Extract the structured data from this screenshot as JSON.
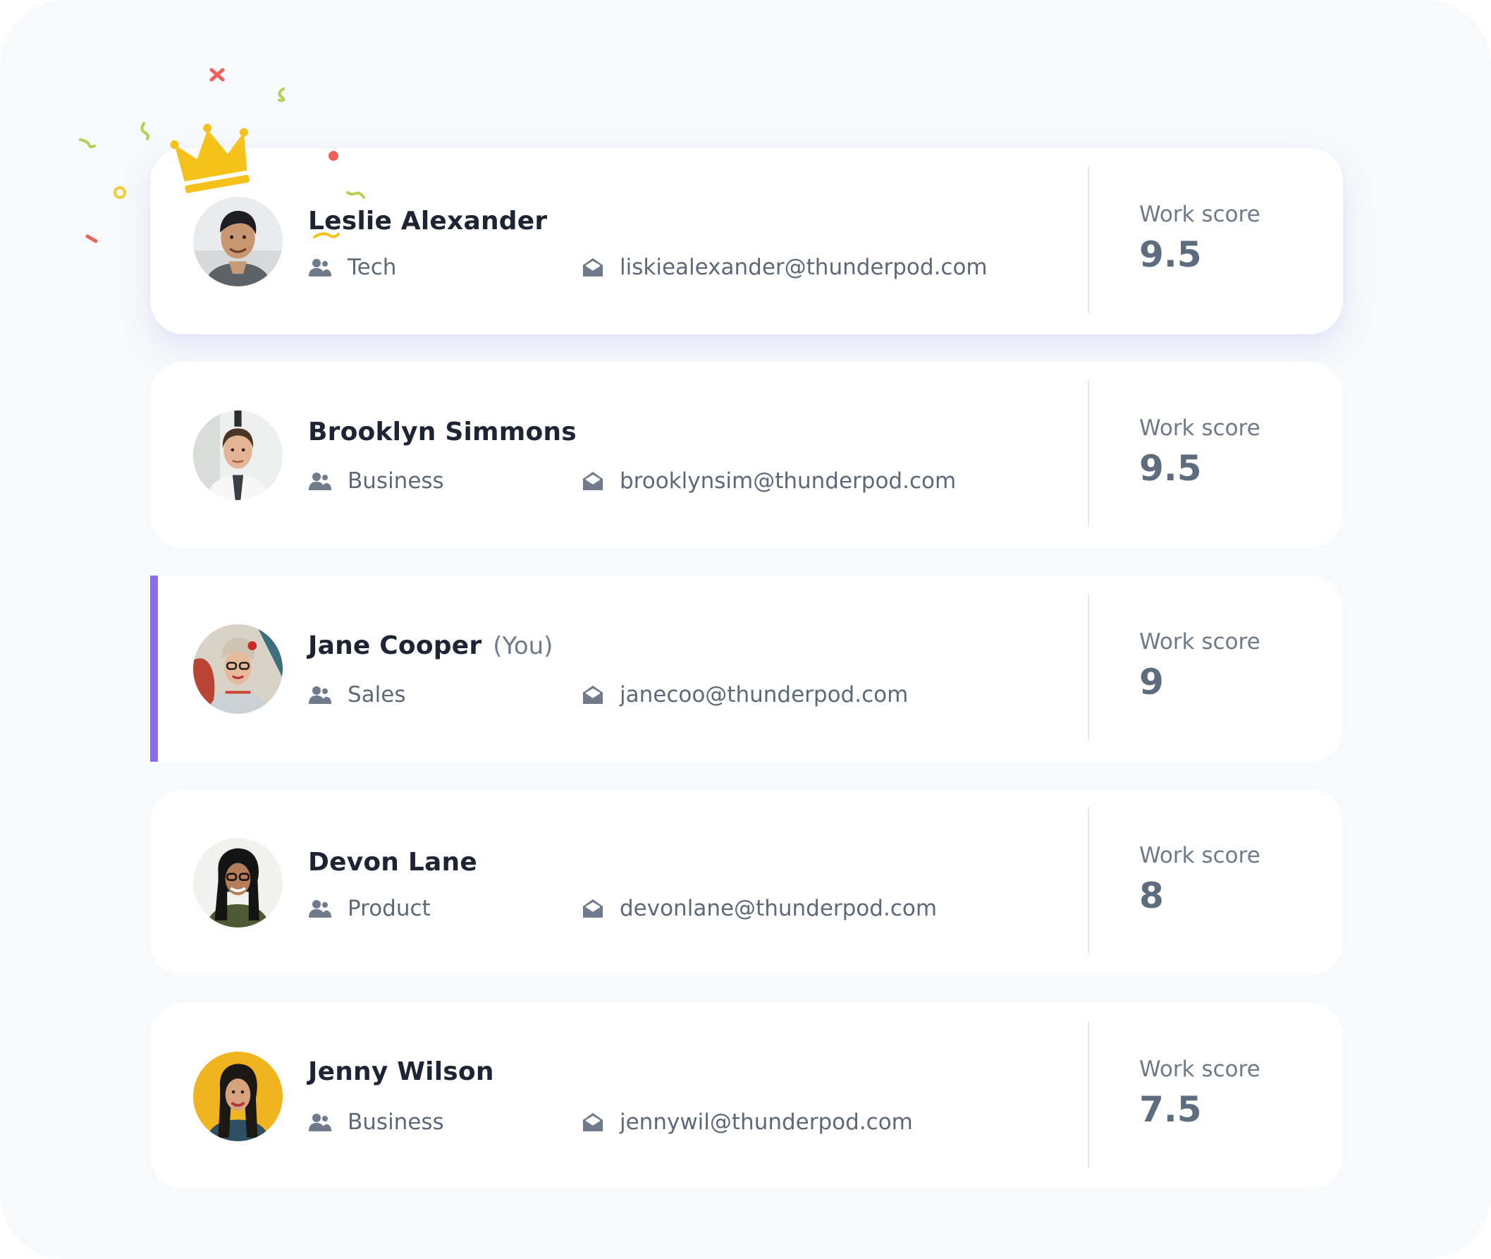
{
  "leaderboard": {
    "score_label": "Work score",
    "accent_color": "#8b6cf0",
    "rows": [
      {
        "name": "Leslie Alexander",
        "you_tag": "",
        "department": "Tech",
        "email": "liskiealexander@thunderpod.com",
        "score": "9.5",
        "is_leader": true,
        "is_current_user": false
      },
      {
        "name": "Brooklyn Simmons",
        "you_tag": "",
        "department": "Business",
        "email": "brooklynsim@thunderpod.com",
        "score": "9.5",
        "is_leader": false,
        "is_current_user": false
      },
      {
        "name": "Jane Cooper",
        "you_tag": "(You)",
        "department": "Sales",
        "email": "janecoo@thunderpod.com",
        "score": "9",
        "is_leader": false,
        "is_current_user": true
      },
      {
        "name": "Devon Lane",
        "you_tag": "",
        "department": "Product",
        "email": "devonlane@thunderpod.com",
        "score": "8",
        "is_leader": false,
        "is_current_user": false
      },
      {
        "name": "Jenny Wilson",
        "you_tag": "",
        "department": "Business",
        "email": "jennywil@thunderpod.com",
        "score": "7.5",
        "is_leader": false,
        "is_current_user": false
      }
    ]
  },
  "icons": {
    "leader_badge": "crown-icon",
    "department": "users-icon",
    "email": "open-envelope-icon"
  }
}
